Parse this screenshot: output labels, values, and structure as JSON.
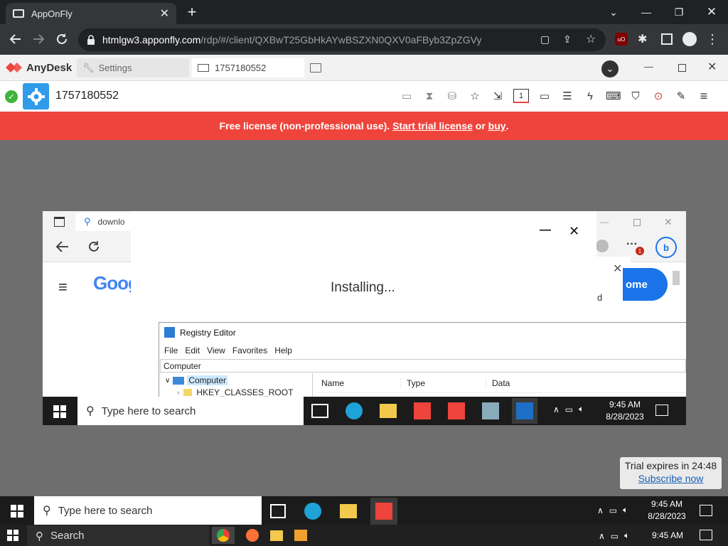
{
  "chrome": {
    "tab_title": "AppOnFly",
    "url_host": "htmlgw3.apponfly.com",
    "url_path": "/rdp/#/client/QXBwT25GbHkAYwBSZXN0QXV0aFByb3ZpZGVy"
  },
  "anydesk": {
    "brand": "AnyDesk",
    "settings_tab": "Settings",
    "session_tab": "1757180552",
    "address": "1757180552",
    "banner": {
      "prefix": "Free license (non-professional use).",
      "trial_link": "Start trial license",
      "or": "or",
      "buy_link": "buy",
      "suffix": "."
    },
    "trial_popup": {
      "text": "Trial expires in 24:48",
      "link": "Subscribe now"
    }
  },
  "remote": {
    "browser_address": "downlo",
    "google_partial": "Goog",
    "dialog_text": "Installing...",
    "popup_partial_btn": "ome",
    "popup_partial_text": "d",
    "registry": {
      "title": "Registry Editor",
      "menu": [
        "File",
        "Edit",
        "View",
        "Favorites",
        "Help"
      ],
      "address": "Computer",
      "tree_root": "Computer",
      "tree_child": "HKEY_CLASSES_ROOT",
      "columns": [
        "Name",
        "Type",
        "Data"
      ]
    },
    "taskbar": {
      "search_placeholder": "Type here to search",
      "time": "9:45 AM",
      "date": "8/28/2023"
    }
  },
  "mid_taskbar": {
    "search_placeholder": "Type here to search",
    "time": "9:45 AM",
    "date": "8/28/2023"
  },
  "host_taskbar": {
    "search_placeholder": "Search",
    "time": "9:45 AM"
  },
  "colors": {
    "chrome_dark": "#202124",
    "chrome_toolbar": "#35363a",
    "anydesk_red": "#ef443b",
    "taskbar": "#1b1b1b"
  }
}
